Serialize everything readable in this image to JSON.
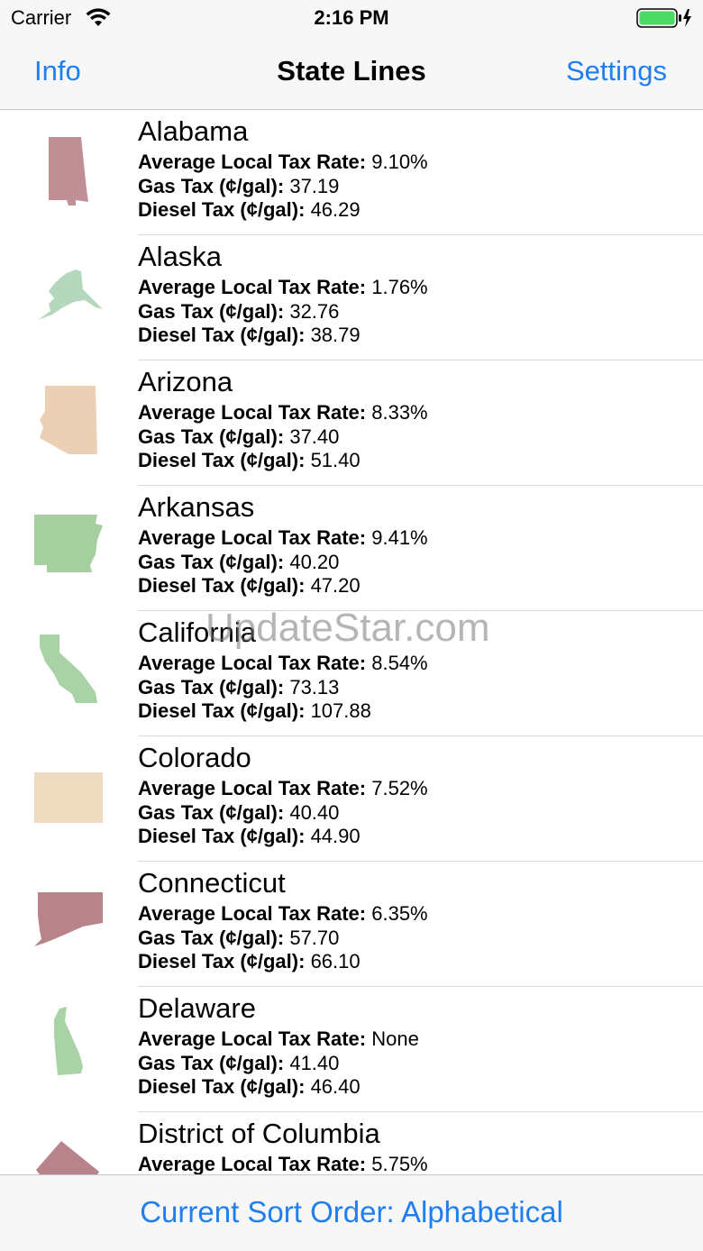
{
  "status": {
    "carrier": "Carrier",
    "time": "2:16 PM",
    "battery_color": "#4cd964"
  },
  "nav": {
    "left": "Info",
    "title": "State Lines",
    "right": "Settings",
    "accent": "#1f7ff0"
  },
  "labels": {
    "avg": "Average Local Tax Rate:",
    "gas": "Gas Tax (¢/gal):",
    "diesel": "Diesel Tax (¢/gal):"
  },
  "states": [
    {
      "name": "Alabama",
      "avg": "9.10%",
      "gas": "37.19",
      "diesel": "46.29",
      "color": "#c08f96",
      "icon": "alabama-shape"
    },
    {
      "name": "Alaska",
      "avg": "1.76%",
      "gas": "32.76",
      "diesel": "38.79",
      "color": "#b5d8bc",
      "icon": "alaska-shape"
    },
    {
      "name": "Arizona",
      "avg": "8.33%",
      "gas": "37.40",
      "diesel": "51.40",
      "color": "#ecd0b6",
      "icon": "arizona-shape"
    },
    {
      "name": "Arkansas",
      "avg": "9.41%",
      "gas": "40.20",
      "diesel": "47.20",
      "color": "#a5cf9f",
      "icon": "arkansas-shape"
    },
    {
      "name": "California",
      "avg": "8.54%",
      "gas": "73.13",
      "diesel": "107.88",
      "color": "#a9d2a6",
      "icon": "california-shape"
    },
    {
      "name": "Colorado",
      "avg": "7.52%",
      "gas": "40.40",
      "diesel": "44.90",
      "color": "#eedbbf",
      "icon": "colorado-shape"
    },
    {
      "name": "Connecticut",
      "avg": "6.35%",
      "gas": "57.70",
      "diesel": "66.10",
      "color": "#b9838b",
      "icon": "connecticut-shape"
    },
    {
      "name": "Delaware",
      "avg": "None",
      "gas": "41.40",
      "diesel": "46.40",
      "color": "#a9d2a6",
      "icon": "delaware-shape"
    },
    {
      "name": "District of Columbia",
      "avg": "5.75%",
      "gas": "",
      "diesel": "",
      "color": "#b9838b",
      "icon": "district-of-columbia-shape"
    }
  ],
  "watermark": "UpdateStar.com",
  "bottom": {
    "sort_label": "Current Sort Order: Alphabetical"
  }
}
